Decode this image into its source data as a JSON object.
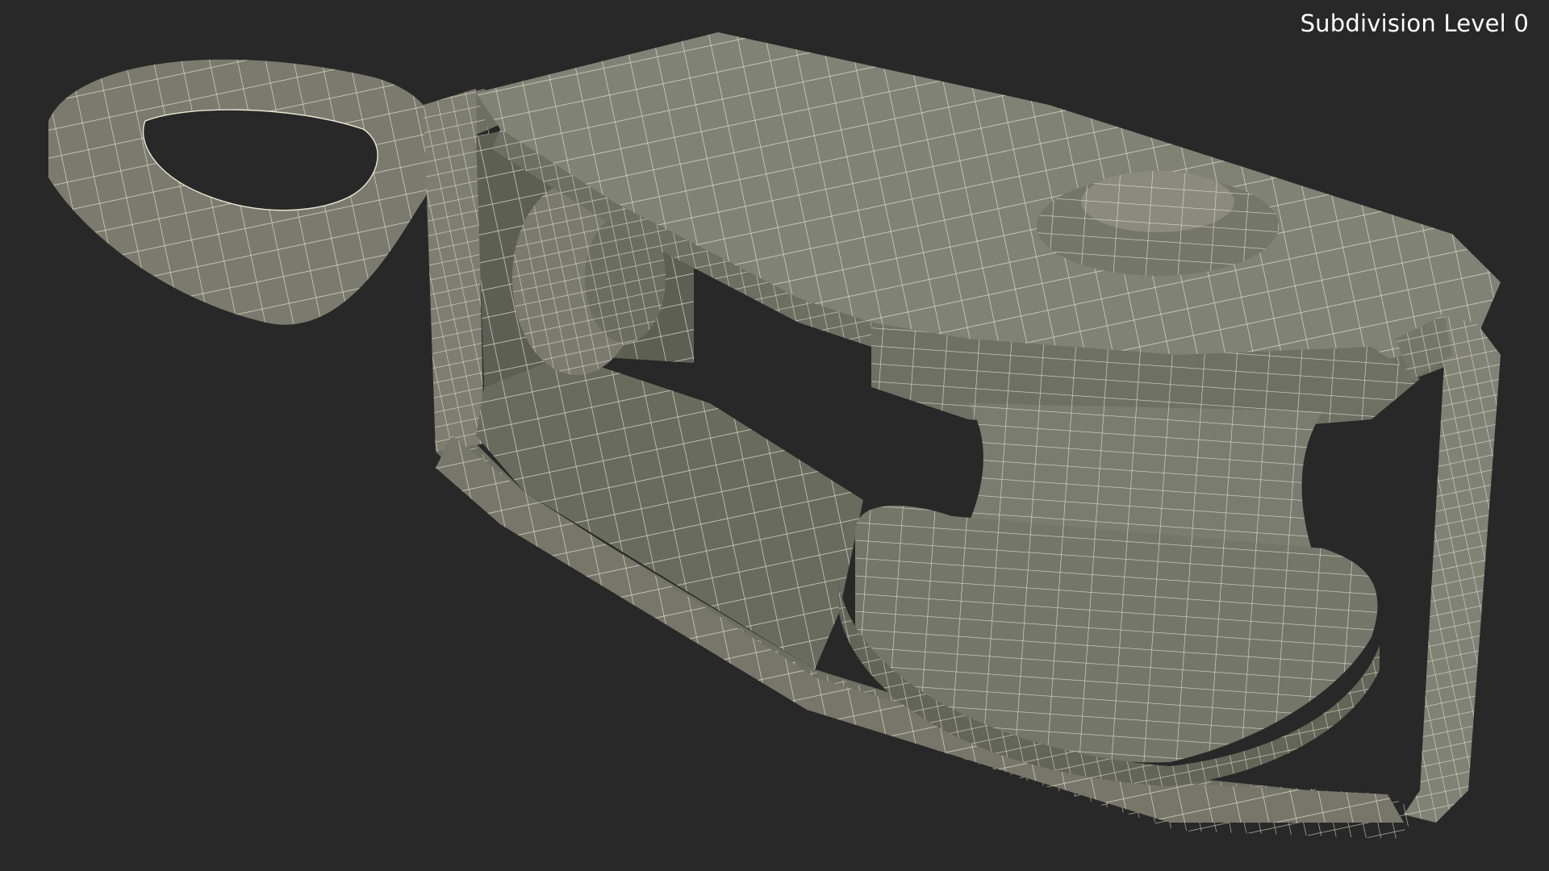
{
  "viewport": {
    "subdivision_label": "Subdivision Level 0",
    "background_color": "#282828",
    "mesh_fill_color": "#7a7b6e",
    "mesh_shadow_color": "#5b5c51",
    "mesh_highlight_color": "#8e8f82",
    "wire_color": "#e8e8d6"
  },
  "model": {
    "icon": "pulley-block-mesh-icon"
  }
}
